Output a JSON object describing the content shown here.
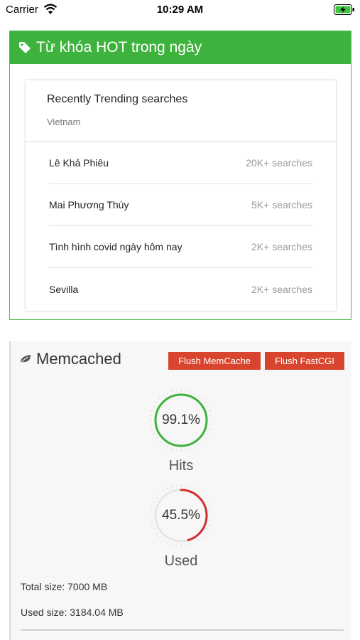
{
  "status_bar": {
    "carrier": "Carrier",
    "time": "10:29 AM",
    "wifi_icon": "wifi-icon",
    "battery_icon": "battery-charging-icon"
  },
  "keywords_card": {
    "title": "Từ khóa HOT trong ngày",
    "icon": "tag-icon",
    "accent": "#3db33d",
    "trending": {
      "title": "Recently Trending searches",
      "region": "Vietnam",
      "items": [
        {
          "term": "Lê Khả Phiêu",
          "count": "20K+ searches"
        },
        {
          "term": "Mai Phương Thúy",
          "count": "5K+ searches"
        },
        {
          "term": "Tình hình covid ngày hôm nay",
          "count": "2K+ searches"
        },
        {
          "term": "Sevilla",
          "count": "2K+ searches"
        }
      ]
    }
  },
  "memcached": {
    "title": "Memcached",
    "icon": "leaf-icon",
    "flush_memcache_label": "Flush MemCache",
    "flush_fastcgi_label": "Flush FastCGI",
    "button_color": "#d9442e",
    "hits": {
      "value_text": "99.1%",
      "fraction": 0.991,
      "label": "Hits",
      "color": "#3db33d"
    },
    "used": {
      "value_text": "45.5%",
      "fraction": 0.455,
      "label": "Used",
      "color": "#d32f2f"
    },
    "total_size": "Total size: 7000 MB",
    "used_size": "Used size: 3184.04 MB"
  }
}
